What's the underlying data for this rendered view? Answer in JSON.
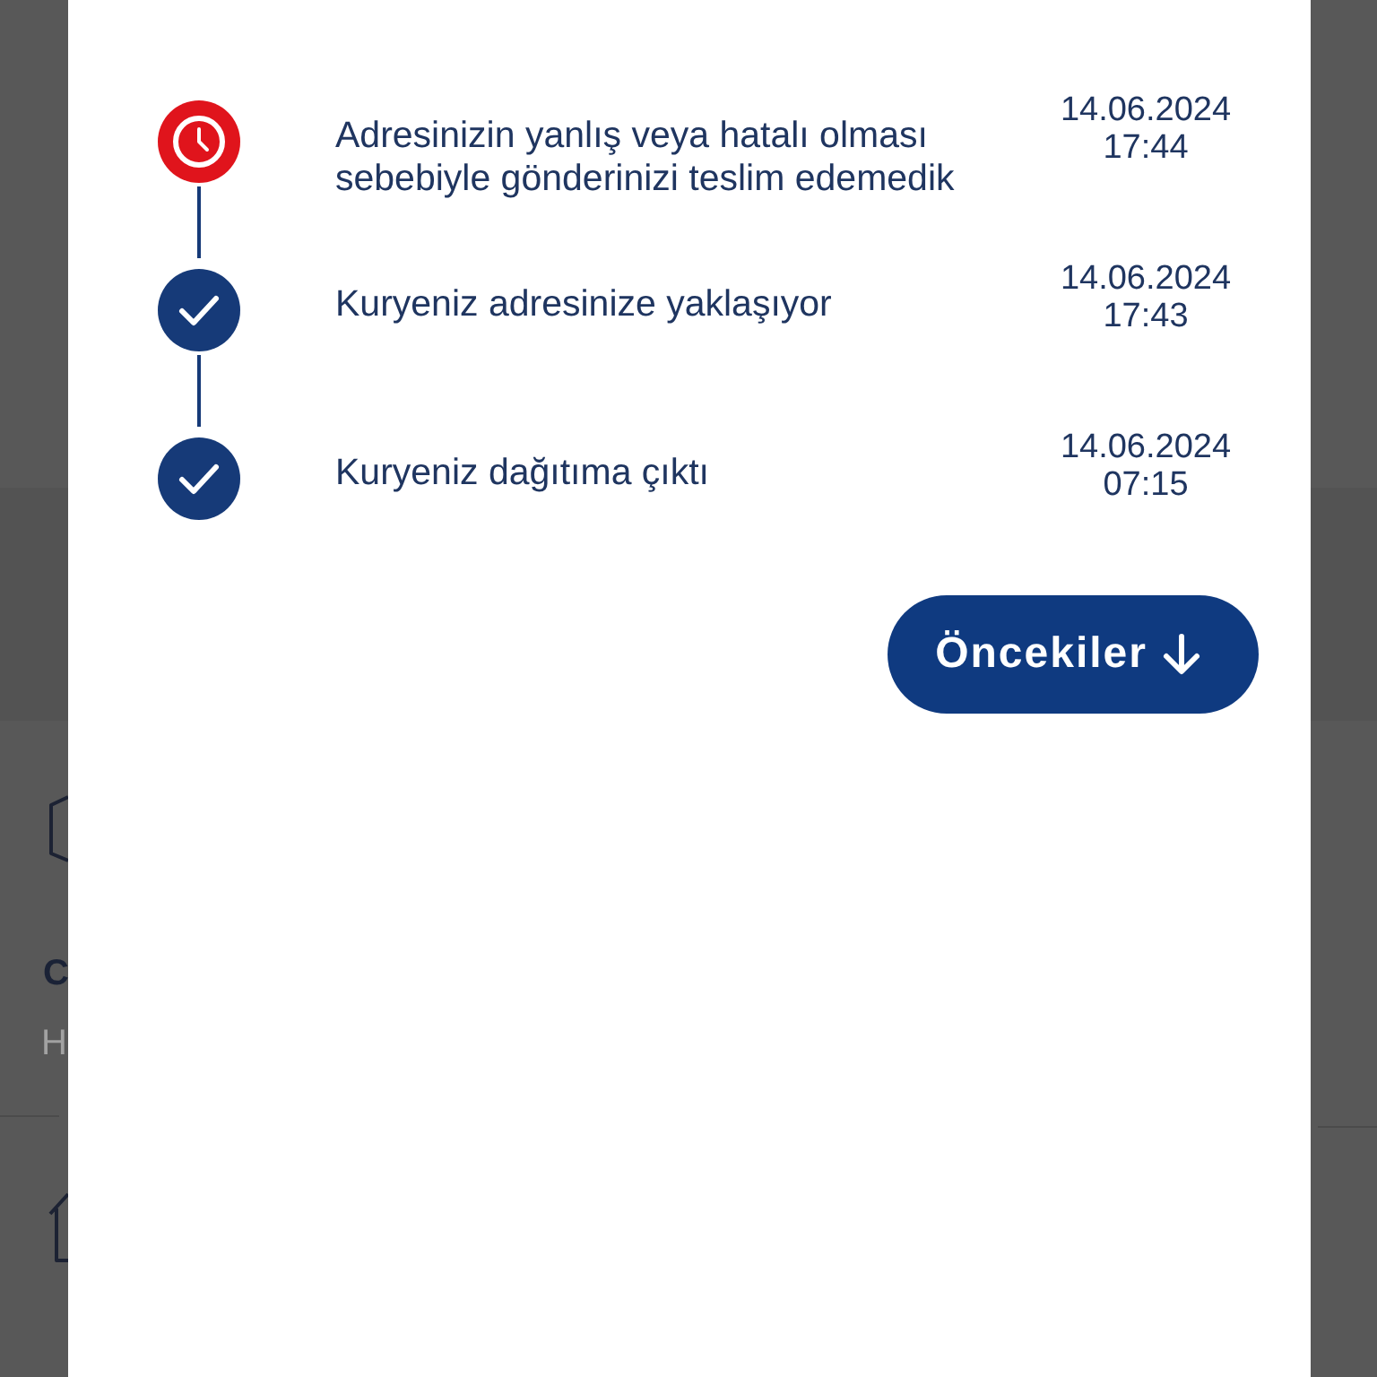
{
  "backdrop": {
    "title": "C",
    "subtitle": "H"
  },
  "events": [
    {
      "kind": "failed",
      "text": "Adresinizin yanlış veya hatalı olması sebebiyle gönderinizi teslim edemedik",
      "date": "14.06.2024",
      "time": "17:44"
    },
    {
      "kind": "done",
      "text": "Kuryeniz adresinize yaklaşıyor",
      "date": "14.06.2024",
      "time": "17:43"
    },
    {
      "kind": "done",
      "text": "Kuryeniz dağıtıma çıktı",
      "date": "14.06.2024",
      "time": "07:15"
    }
  ],
  "button": {
    "label": "Öncekiler"
  }
}
